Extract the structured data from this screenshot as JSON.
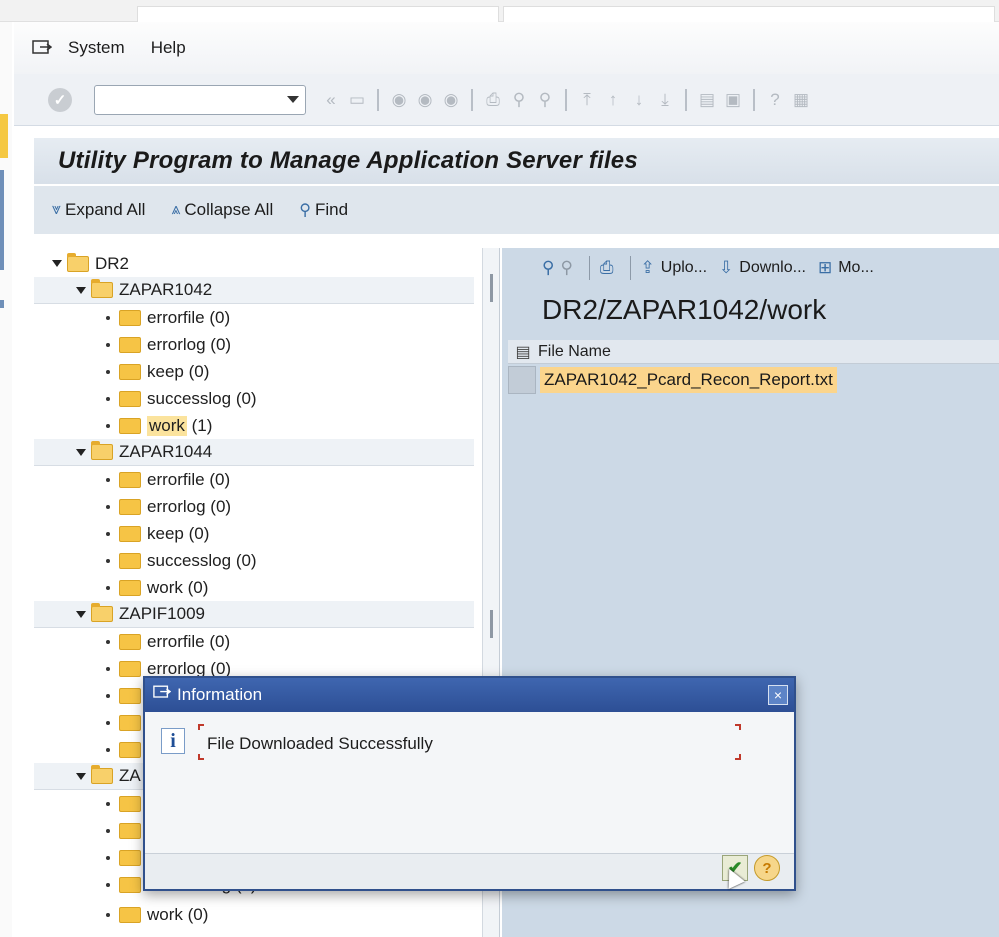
{
  "menu": {
    "system_label": "System",
    "help_label": "Help"
  },
  "toolbar": {
    "command_field_value": "",
    "icons": [
      "enter-icon",
      "back-icon",
      "save-icon",
      "back-nav-icon",
      "exit-icon",
      "cancel-icon",
      "print-icon",
      "find-icon",
      "find-next-icon",
      "first-page-icon",
      "prev-page-icon",
      "next-page-icon",
      "last-page-icon",
      "new-session-icon",
      "shortcut-icon",
      "help-icon",
      "layout-icon"
    ]
  },
  "page": {
    "title": "Utility Program to Manage Application Server files"
  },
  "app_toolbar": {
    "expand_label": "Expand All",
    "collapse_label": "Collapse All",
    "find_label": "Find"
  },
  "tree": {
    "root": "DR2",
    "groups": [
      {
        "name": "ZAPAR1042",
        "children": [
          "errorfile (0)",
          "errorlog (0)",
          "keep (0)",
          "successlog (0)",
          "work (1)"
        ],
        "selected_child": "work",
        "selected_suffix": "(1)"
      },
      {
        "name": "ZAPAR1044",
        "children": [
          "errorfile (0)",
          "errorlog (0)",
          "keep (0)",
          "successlog (0)",
          "work (0)"
        ]
      },
      {
        "name": "ZAPIF1009",
        "children": [
          "errorfile (0)",
          "errorlog (0)"
        ]
      },
      {
        "name": "ZA",
        "children": [
          "successlog (0)",
          "work (0)"
        ]
      }
    ]
  },
  "right": {
    "upload_label": "Uplo...",
    "download_label": "Downlo...",
    "more_label": "Mo...",
    "path": "DR2/ZAPAR1042/work",
    "column_header": "File Name",
    "file": "ZAPAR1042_Pcard_Recon_Report.txt"
  },
  "dialog": {
    "title": "Information",
    "message": "File Downloaded Successfully",
    "close_label": "×",
    "info_label": "i",
    "ok_label": "✔",
    "help_label": "?"
  }
}
